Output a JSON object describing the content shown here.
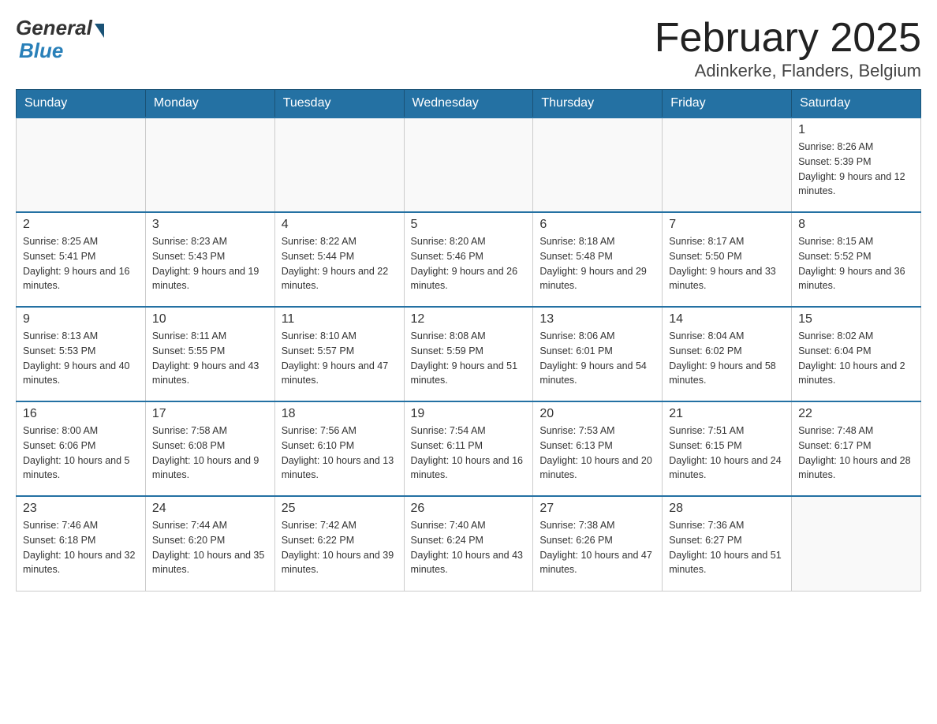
{
  "header": {
    "logo_general": "General",
    "logo_blue": "Blue",
    "month_title": "February 2025",
    "location": "Adinkerke, Flanders, Belgium"
  },
  "weekdays": [
    "Sunday",
    "Monday",
    "Tuesday",
    "Wednesday",
    "Thursday",
    "Friday",
    "Saturday"
  ],
  "weeks": [
    {
      "days": [
        {
          "num": "",
          "info": ""
        },
        {
          "num": "",
          "info": ""
        },
        {
          "num": "",
          "info": ""
        },
        {
          "num": "",
          "info": ""
        },
        {
          "num": "",
          "info": ""
        },
        {
          "num": "",
          "info": ""
        },
        {
          "num": "1",
          "info": "Sunrise: 8:26 AM\nSunset: 5:39 PM\nDaylight: 9 hours and 12 minutes."
        }
      ]
    },
    {
      "days": [
        {
          "num": "2",
          "info": "Sunrise: 8:25 AM\nSunset: 5:41 PM\nDaylight: 9 hours and 16 minutes."
        },
        {
          "num": "3",
          "info": "Sunrise: 8:23 AM\nSunset: 5:43 PM\nDaylight: 9 hours and 19 minutes."
        },
        {
          "num": "4",
          "info": "Sunrise: 8:22 AM\nSunset: 5:44 PM\nDaylight: 9 hours and 22 minutes."
        },
        {
          "num": "5",
          "info": "Sunrise: 8:20 AM\nSunset: 5:46 PM\nDaylight: 9 hours and 26 minutes."
        },
        {
          "num": "6",
          "info": "Sunrise: 8:18 AM\nSunset: 5:48 PM\nDaylight: 9 hours and 29 minutes."
        },
        {
          "num": "7",
          "info": "Sunrise: 8:17 AM\nSunset: 5:50 PM\nDaylight: 9 hours and 33 minutes."
        },
        {
          "num": "8",
          "info": "Sunrise: 8:15 AM\nSunset: 5:52 PM\nDaylight: 9 hours and 36 minutes."
        }
      ]
    },
    {
      "days": [
        {
          "num": "9",
          "info": "Sunrise: 8:13 AM\nSunset: 5:53 PM\nDaylight: 9 hours and 40 minutes."
        },
        {
          "num": "10",
          "info": "Sunrise: 8:11 AM\nSunset: 5:55 PM\nDaylight: 9 hours and 43 minutes."
        },
        {
          "num": "11",
          "info": "Sunrise: 8:10 AM\nSunset: 5:57 PM\nDaylight: 9 hours and 47 minutes."
        },
        {
          "num": "12",
          "info": "Sunrise: 8:08 AM\nSunset: 5:59 PM\nDaylight: 9 hours and 51 minutes."
        },
        {
          "num": "13",
          "info": "Sunrise: 8:06 AM\nSunset: 6:01 PM\nDaylight: 9 hours and 54 minutes."
        },
        {
          "num": "14",
          "info": "Sunrise: 8:04 AM\nSunset: 6:02 PM\nDaylight: 9 hours and 58 minutes."
        },
        {
          "num": "15",
          "info": "Sunrise: 8:02 AM\nSunset: 6:04 PM\nDaylight: 10 hours and 2 minutes."
        }
      ]
    },
    {
      "days": [
        {
          "num": "16",
          "info": "Sunrise: 8:00 AM\nSunset: 6:06 PM\nDaylight: 10 hours and 5 minutes."
        },
        {
          "num": "17",
          "info": "Sunrise: 7:58 AM\nSunset: 6:08 PM\nDaylight: 10 hours and 9 minutes."
        },
        {
          "num": "18",
          "info": "Sunrise: 7:56 AM\nSunset: 6:10 PM\nDaylight: 10 hours and 13 minutes."
        },
        {
          "num": "19",
          "info": "Sunrise: 7:54 AM\nSunset: 6:11 PM\nDaylight: 10 hours and 16 minutes."
        },
        {
          "num": "20",
          "info": "Sunrise: 7:53 AM\nSunset: 6:13 PM\nDaylight: 10 hours and 20 minutes."
        },
        {
          "num": "21",
          "info": "Sunrise: 7:51 AM\nSunset: 6:15 PM\nDaylight: 10 hours and 24 minutes."
        },
        {
          "num": "22",
          "info": "Sunrise: 7:48 AM\nSunset: 6:17 PM\nDaylight: 10 hours and 28 minutes."
        }
      ]
    },
    {
      "days": [
        {
          "num": "23",
          "info": "Sunrise: 7:46 AM\nSunset: 6:18 PM\nDaylight: 10 hours and 32 minutes."
        },
        {
          "num": "24",
          "info": "Sunrise: 7:44 AM\nSunset: 6:20 PM\nDaylight: 10 hours and 35 minutes."
        },
        {
          "num": "25",
          "info": "Sunrise: 7:42 AM\nSunset: 6:22 PM\nDaylight: 10 hours and 39 minutes."
        },
        {
          "num": "26",
          "info": "Sunrise: 7:40 AM\nSunset: 6:24 PM\nDaylight: 10 hours and 43 minutes."
        },
        {
          "num": "27",
          "info": "Sunrise: 7:38 AM\nSunset: 6:26 PM\nDaylight: 10 hours and 47 minutes."
        },
        {
          "num": "28",
          "info": "Sunrise: 7:36 AM\nSunset: 6:27 PM\nDaylight: 10 hours and 51 minutes."
        },
        {
          "num": "",
          "info": ""
        }
      ]
    }
  ]
}
